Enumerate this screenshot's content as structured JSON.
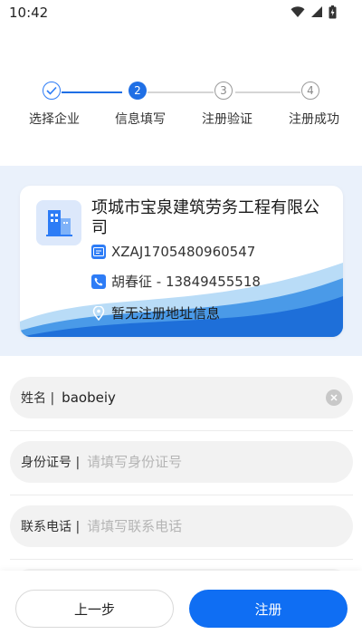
{
  "status": {
    "time": "10:42"
  },
  "steps": [
    {
      "number": "",
      "label": "选择企业",
      "state": "done"
    },
    {
      "number": "2",
      "label": "信息填写",
      "state": "active"
    },
    {
      "number": "3",
      "label": "注册验证",
      "state": "pending"
    },
    {
      "number": "4",
      "label": "注册成功",
      "state": "pending"
    }
  ],
  "company": {
    "name": "项城市宝泉建筑劳务工程有限公司",
    "code": "XZAJ1705480960547",
    "contact": "胡春征 - 13849455518",
    "address": "暂无注册地址信息"
  },
  "form": {
    "name": {
      "label": "姓名 |",
      "value": "baobeiy",
      "placeholder": ""
    },
    "id_number": {
      "label": "身份证号 |",
      "value": "",
      "placeholder": "请填写身份证号"
    },
    "phone": {
      "label": "联系电话 |",
      "value": "",
      "placeholder": "请填写联系电话"
    }
  },
  "buttons": {
    "prev": "上一步",
    "register": "注册"
  },
  "colors": {
    "accent": "#0f6ef3",
    "card_wave": "#2d7cf6",
    "card_bg": "#eaf1fb"
  }
}
